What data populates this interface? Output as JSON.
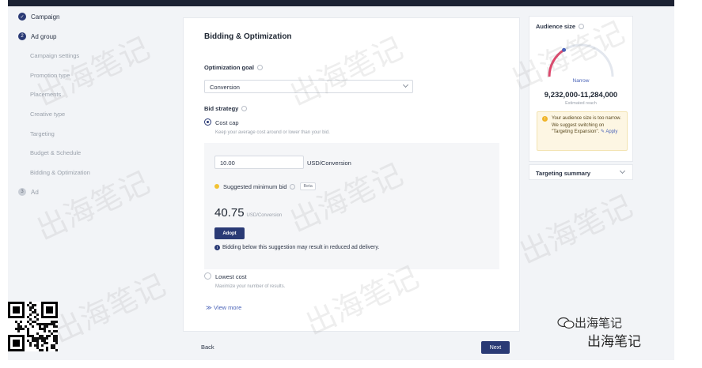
{
  "sidebar": {
    "steps": [
      {
        "label": "Campaign",
        "marker": "✓"
      },
      {
        "label": "Ad group",
        "marker": "2"
      },
      {
        "label": "Ad",
        "marker": "3"
      }
    ],
    "substeps": [
      "Campaign settings",
      "Promotion type",
      "Placements",
      "Creative type",
      "Targeting",
      "Budget & Schedule",
      "Bidding & Optimization"
    ]
  },
  "main": {
    "title": "Bidding & Optimization",
    "optimization_goal_label": "Optimization goal",
    "optimization_goal_value": "Conversion",
    "bid_strategy_label": "Bid strategy",
    "cost_cap_label": "Cost cap",
    "cost_cap_desc": "Keep your average cost around or lower than your bid.",
    "bid_value": "10.00",
    "bid_unit": "USD/Conversion",
    "suggested_label": "Suggested minimum bid",
    "beta_label": "Beta",
    "suggested_value": "40.75",
    "suggested_unit": "USD/Conversion",
    "adopt_label": "Adopt",
    "warning_note": "Bidding below this suggestion may result in reduced ad delivery.",
    "lowest_cost_label": "Lowest cost",
    "lowest_cost_desc": "Maximize your number of results.",
    "view_more_label": "View more"
  },
  "footer": {
    "back_label": "Back",
    "next_label": "Next"
  },
  "audience": {
    "title": "Audience size",
    "level": "Narrow",
    "range": "9,232,000-11,284,000",
    "estimate_label": "Estimated reach",
    "warning_text": "Your audience size is too narrow. We suggest switching on \"Targeting Expansion\".",
    "apply_label": "Apply",
    "gauge_level": 0.32
  },
  "targeting_summary": {
    "title": "Targeting summary"
  },
  "watermark": {
    "text": "出海笔记"
  },
  "brand": {
    "wechat_text": "出海笔记",
    "footer_text": "出海笔记"
  },
  "colors": {
    "primary": "#2a3a75",
    "accent": "#4a63b8",
    "warning": "#f0b429",
    "gauge_low": "#e0456b"
  }
}
